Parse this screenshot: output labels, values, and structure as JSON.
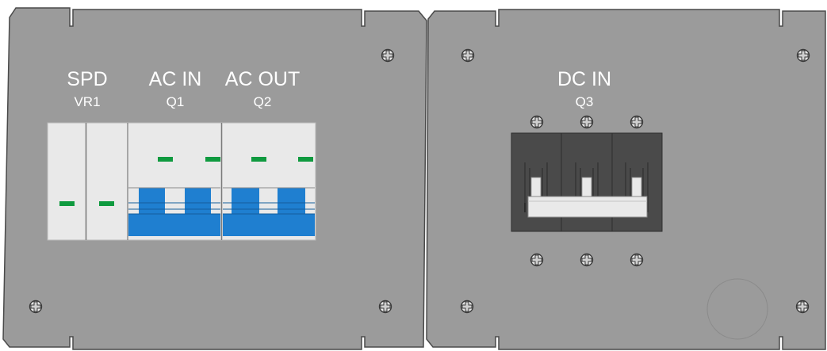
{
  "colors": {
    "panel": "#9b9b9b",
    "panel_edge": "#4a4a4a",
    "breaker_white": "#e9e9e9",
    "breaker_blue": "#1f7fd0",
    "indicator_green": "#0f9a3f",
    "dc_breaker_dark": "#4a4a4a",
    "text": "#ffffff"
  },
  "left_panel": {
    "labels": {
      "spd_title": "SPD",
      "spd_code": "VR1",
      "ac_in_title": "AC IN",
      "ac_in_code": "Q1",
      "ac_out_title": "AC OUT",
      "ac_out_code": "Q2"
    }
  },
  "right_panel": {
    "labels": {
      "dc_in_title": "DC IN",
      "dc_in_code": "Q3"
    }
  },
  "icons": {
    "screw": "screw-icon"
  }
}
